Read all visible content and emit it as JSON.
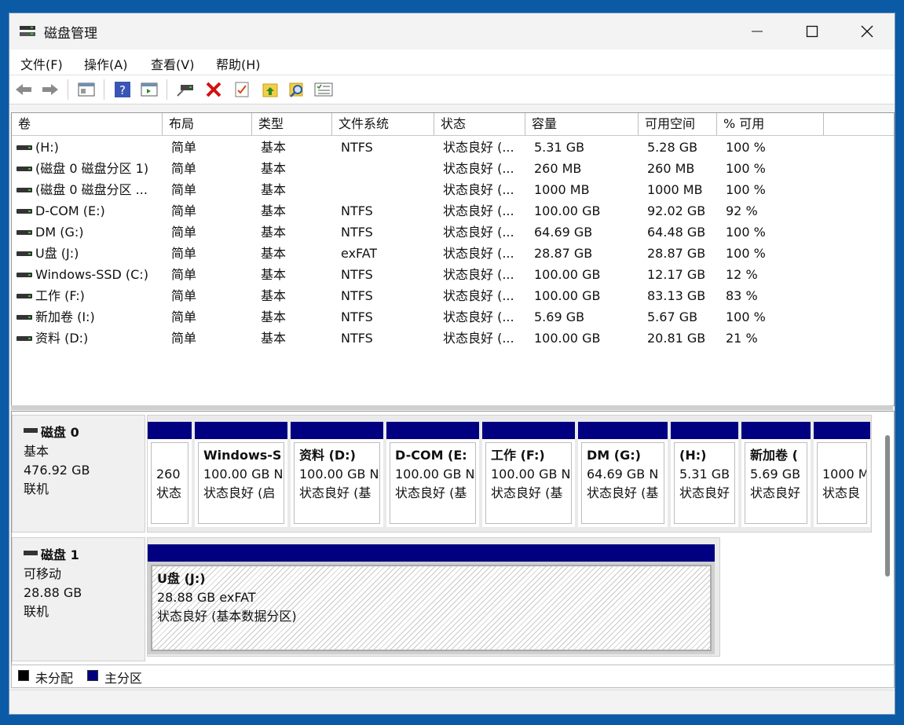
{
  "window": {
    "title": "磁盘管理"
  },
  "menu": [
    "文件(F)",
    "操作(A)",
    "查看(V)",
    "帮助(H)"
  ],
  "toolbar": [
    "back-icon",
    "forward-icon",
    "console-tree-icon",
    "help-icon",
    "action-pane-icon",
    "connect-drive-icon",
    "delete-icon",
    "properties-icon",
    "folder-up-icon",
    "search-icon",
    "list-icon"
  ],
  "colors": {
    "primary_partition": "#000080",
    "unallocated": "#000000"
  },
  "volumes": {
    "columns": [
      "卷",
      "布局",
      "类型",
      "文件系统",
      "状态",
      "容量",
      "可用空间",
      "% 可用"
    ],
    "rows": [
      [
        "(H:)",
        "简单",
        "基本",
        "NTFS",
        "状态良好 (...",
        "5.31 GB",
        "5.28 GB",
        "100 %"
      ],
      [
        "(磁盘 0 磁盘分区 1)",
        "简单",
        "基本",
        "",
        "状态良好 (...",
        "260 MB",
        "260 MB",
        "100 %"
      ],
      [
        "(磁盘 0 磁盘分区 ...",
        "简单",
        "基本",
        "",
        "状态良好 (...",
        "1000 MB",
        "1000 MB",
        "100 %"
      ],
      [
        "D-COM (E:)",
        "简单",
        "基本",
        "NTFS",
        "状态良好 (...",
        "100.00 GB",
        "92.02 GB",
        "92 %"
      ],
      [
        "DM (G:)",
        "简单",
        "基本",
        "NTFS",
        "状态良好 (...",
        "64.69 GB",
        "64.48 GB",
        "100 %"
      ],
      [
        "U盘 (J:)",
        "简单",
        "基本",
        "exFAT",
        "状态良好 (...",
        "28.87 GB",
        "28.87 GB",
        "100 %"
      ],
      [
        "Windows-SSD (C:)",
        "简单",
        "基本",
        "NTFS",
        "状态良好 (...",
        "100.00 GB",
        "12.17 GB",
        "12 %"
      ],
      [
        "工作 (F:)",
        "简单",
        "基本",
        "NTFS",
        "状态良好 (...",
        "100.00 GB",
        "83.13 GB",
        "83 %"
      ],
      [
        "新加卷 (I:)",
        "简单",
        "基本",
        "NTFS",
        "状态良好 (...",
        "5.69 GB",
        "5.67 GB",
        "100 %"
      ],
      [
        "资料 (D:)",
        "简单",
        "基本",
        "NTFS",
        "状态良好 (...",
        "100.00 GB",
        "20.81 GB",
        "21 %"
      ]
    ]
  },
  "disks": [
    {
      "name": "磁盘 0",
      "type": "基本",
      "size": "476.92 GB",
      "status": "联机",
      "partitions": [
        {
          "name": "",
          "size": "260",
          "status": "状态"
        },
        {
          "name": "Windows-S",
          "size": "100.00 GB N",
          "status": "状态良好 (启"
        },
        {
          "name": "资料 (D:)",
          "size": "100.00 GB N",
          "status": "状态良好 (基"
        },
        {
          "name": "D-COM (E:",
          "size": "100.00 GB N",
          "status": "状态良好 (基"
        },
        {
          "name": "工作 (F:)",
          "size": "100.00 GB N",
          "status": "状态良好 (基"
        },
        {
          "name": "DM (G:)",
          "size": "64.69 GB N",
          "status": "状态良好 (基"
        },
        {
          "name": "(H:)",
          "size": "5.31 GB",
          "status": "状态良好"
        },
        {
          "name": "新加卷 (",
          "size": "5.69 GB",
          "status": "状态良好"
        },
        {
          "name": "",
          "size": "1000 M",
          "status": "状态良"
        }
      ]
    },
    {
      "name": "磁盘 1",
      "type": "可移动",
      "size": "28.88 GB",
      "status": "联机",
      "partitions": [
        {
          "name": "U盘 (J:)",
          "size": "28.88 GB exFAT",
          "status": "状态良好 (基本数据分区)"
        }
      ]
    }
  ],
  "legend": [
    "未分配",
    "主分区"
  ]
}
